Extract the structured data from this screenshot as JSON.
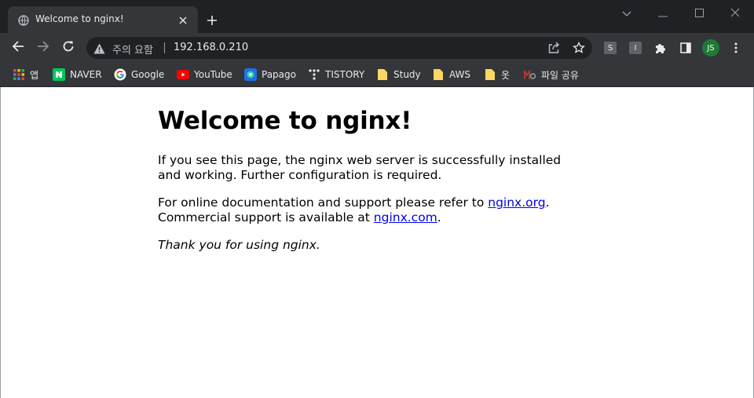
{
  "browser": {
    "tab": {
      "title": "Welcome to nginx!"
    },
    "omnibox": {
      "security_label": "주의 요함",
      "url": "192.168.0.210"
    },
    "extensions": [
      "S",
      "I"
    ],
    "profile_initials": "JS",
    "bookmarks": [
      {
        "label": "앱",
        "icon": "apps-grid-icon"
      },
      {
        "label": "NAVER",
        "icon": "naver-icon"
      },
      {
        "label": "Google",
        "icon": "google-icon"
      },
      {
        "label": "YouTube",
        "icon": "youtube-icon"
      },
      {
        "label": "Papago",
        "icon": "papago-icon"
      },
      {
        "label": "TISTORY",
        "icon": "tistory-icon"
      },
      {
        "label": "Study",
        "icon": "folder-icon"
      },
      {
        "label": "AWS",
        "icon": "folder-icon"
      },
      {
        "label": "옷",
        "icon": "folder-icon"
      },
      {
        "label": "파일 공유",
        "icon": "file-share-icon"
      }
    ],
    "colors": {
      "frame": "#202124",
      "toolbar": "#35363a",
      "link": "#0000ee",
      "avatar": "#1e7a34"
    }
  },
  "page": {
    "heading": "Welcome to nginx!",
    "para1": "If you see this page, the nginx web server is successfully installed and working. Further configuration is required.",
    "para2_prefix": "For online documentation and support please refer to ",
    "link1": "nginx.org",
    "para2_mid": ".",
    "para2_line2": "Commercial support is available at ",
    "link2": "nginx.com",
    "para2_end": ".",
    "thanks": "Thank you for using nginx."
  }
}
